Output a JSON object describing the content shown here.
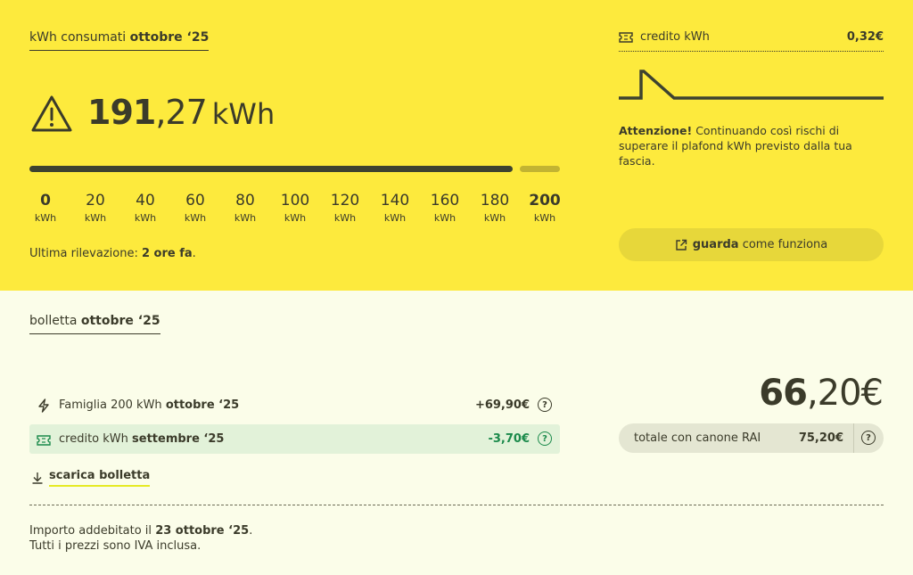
{
  "consumption": {
    "title_prefix": "kWh consumati",
    "title_period": "ottobre ‘25",
    "reading_int": "191",
    "reading_dec": ",27",
    "reading_unit": "kWh",
    "progress_fraction": 0.956,
    "scale": [
      {
        "value": "0",
        "unit": "kWh"
      },
      {
        "value": "20",
        "unit": "kWh"
      },
      {
        "value": "40",
        "unit": "kWh"
      },
      {
        "value": "60",
        "unit": "kWh"
      },
      {
        "value": "80",
        "unit": "kWh"
      },
      {
        "value": "100",
        "unit": "kWh"
      },
      {
        "value": "120",
        "unit": "kWh"
      },
      {
        "value": "140",
        "unit": "kWh"
      },
      {
        "value": "160",
        "unit": "kWh"
      },
      {
        "value": "180",
        "unit": "kWh"
      },
      {
        "value": "200",
        "unit": "kWh"
      }
    ],
    "last_reading_label": "Ultima rilevazione:",
    "last_reading_value": "2 ore fa",
    "last_reading_end": ".",
    "warning_icon": "warning-triangle-icon"
  },
  "credit_panel": {
    "icon": "ticket-icon",
    "label": "credito kWh",
    "value": "0,32€",
    "attention_bold": "Attenzione!",
    "attention_text": " Continuando così rischi di superare il plafond kWh previsto dalla tua fascia.",
    "button_bold": "guarda",
    "button_text": "come funziona",
    "button_icon": "external-link-icon"
  },
  "bill": {
    "title_prefix": "bolletta",
    "title_period": "ottobre ‘25",
    "lines": [
      {
        "icon": "bolt-icon",
        "label": "Famiglia 200 kWh",
        "period": "ottobre ‘25",
        "amount": "+69,90€",
        "help": "?"
      },
      {
        "icon": "ticket-icon",
        "label": "credito kWh",
        "period": "settembre ‘25",
        "amount": "-3,70€",
        "help": "?"
      }
    ],
    "download_label": "scarica bolletta",
    "total_int": "66",
    "total_dec": ",20€",
    "canone_label": "totale con canone RAI",
    "canone_value": "75,20€",
    "canone_help": "?",
    "charged_prefix": "Importo addebitato il",
    "charged_date": "23 ottobre ‘25",
    "charged_end": ".",
    "vat_note": "Tutti i prezzi sono IVA inclusa."
  },
  "colors": {
    "top_bg": "#fdea3d",
    "bottom_bg": "#fbfde9",
    "text": "#3b3b2a",
    "credit_green": "#1b8a4b",
    "credit_row_bg": "#e2f2d9"
  }
}
